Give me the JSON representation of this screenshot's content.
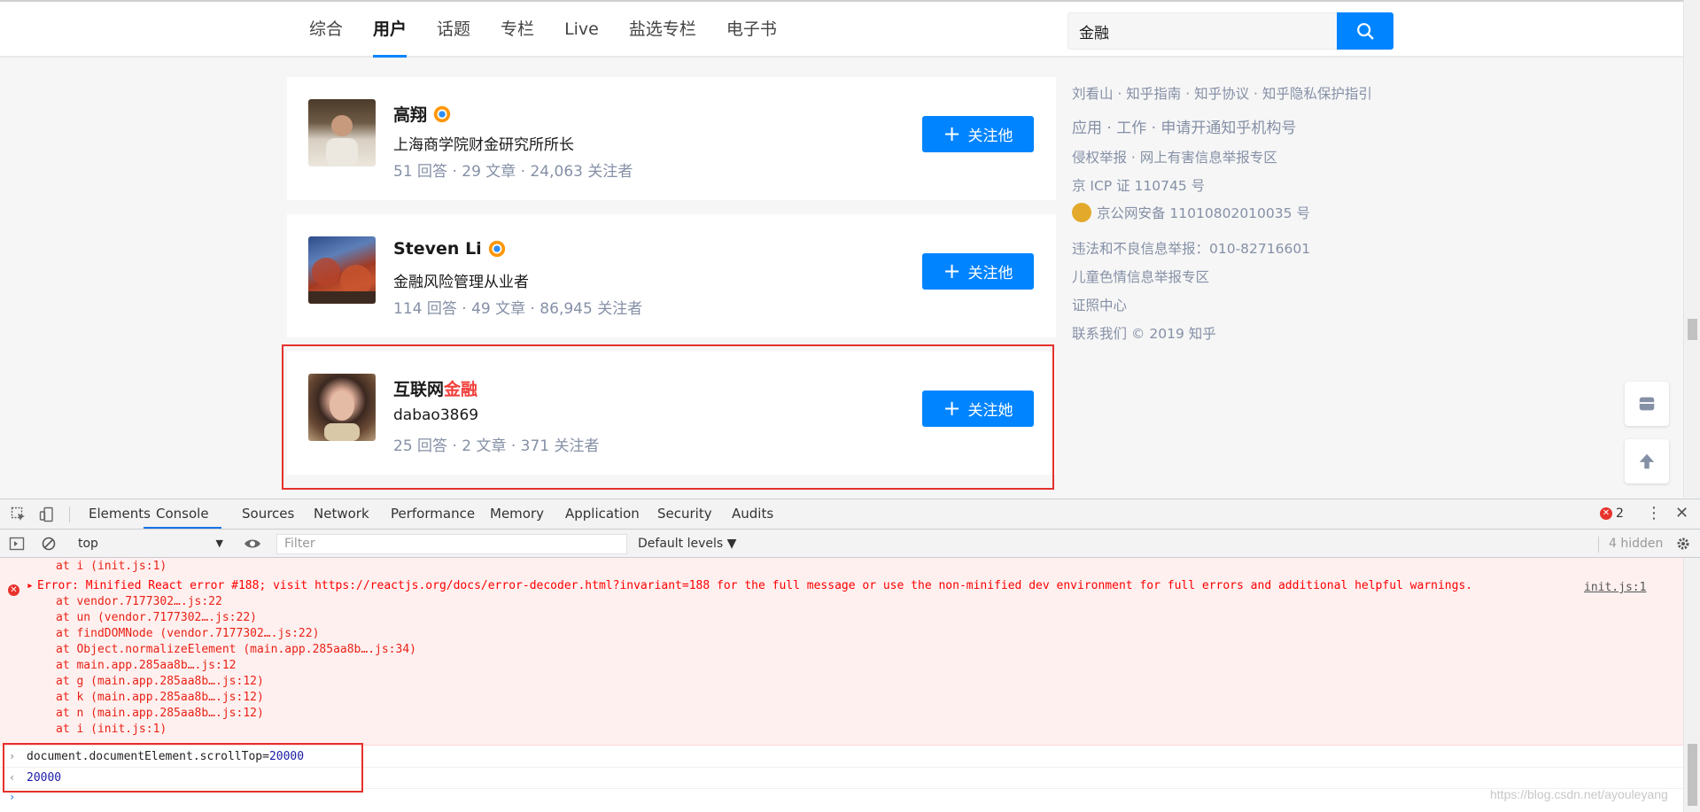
{
  "nav": {
    "tabs": [
      "综合",
      "用户",
      "话题",
      "专栏",
      "Live",
      "盐选专栏",
      "电子书"
    ],
    "active_tab": "用户"
  },
  "search": {
    "value": "金融",
    "icon": "search-icon"
  },
  "users": [
    {
      "name": "高翔",
      "verified": true,
      "headline": "上海商学院财金研究所所长",
      "stats": "51 回答 · 29 文章 · 24,063 关注者",
      "follow_label": "关注他"
    },
    {
      "name": "Steven Li",
      "verified": true,
      "headline": "金融风险管理从业者",
      "stats": "114 回答 · 49 文章 · 86,945 关注者",
      "follow_label": "关注他"
    },
    {
      "name_prefix": "互联网",
      "name_highlight": "金融",
      "verified": false,
      "headline": "dabao3869",
      "stats": "25 回答 · 2 文章 · 371 关注者",
      "follow_label": "关注她"
    }
  ],
  "footer": {
    "line1": "刘看山 · 知乎指南 · 知乎协议 · 知乎隐私保护指引",
    "line2": "应用 · 工作 · 申请开通知乎机构号",
    "line3": "侵权举报 · 网上有害信息举报专区",
    "line4": "京 ICP 证 110745 号",
    "line5": "京公网安备 11010802010035 号",
    "line6": "违法和不良信息举报：010-82716601",
    "line7": "儿童色情信息举报专区",
    "line8": "证照中心",
    "line9": "联系我们 © 2019 知乎"
  },
  "devtools": {
    "tabs": [
      "Elements",
      "Console",
      "Sources",
      "Network",
      "Performance",
      "Memory",
      "Application",
      "Security",
      "Audits"
    ],
    "active_tab": "Console",
    "error_count": "2",
    "context": "top",
    "filter_placeholder": "Filter",
    "levels": "Default levels ▼",
    "hidden": "4 hidden",
    "console": {
      "prev_stack": "at i (init.js:1)",
      "error_message": "Error: Minified React error #188; visit https://reactjs.org/docs/error-decoder.html?invariant=188 for the full message or use the non-minified dev environment for full errors and additional helpful warnings.",
      "error_source": "init.js:1",
      "stack": [
        "at vendor.7177302….js:22",
        "at un (vendor.7177302….js:22)",
        "at findDOMNode (vendor.7177302….js:22)",
        "at Object.normalizeElement (main.app.285aa8b….js:34)",
        "at main.app.285aa8b….js:12",
        "at g (main.app.285aa8b….js:12)",
        "at k (main.app.285aa8b….js:12)",
        "at n (main.app.285aa8b….js:12)",
        "at i (init.js:1)"
      ],
      "command_prefix": "document.documentElement.scrollTop=",
      "command_value": "20000",
      "result": "20000"
    }
  },
  "watermark": "https://blog.csdn.net/ayouleyang",
  "colors": {
    "accent": "#0084ff",
    "highlight": "#f1403c",
    "annotation": "#e5312c",
    "error": "#ff0000"
  }
}
